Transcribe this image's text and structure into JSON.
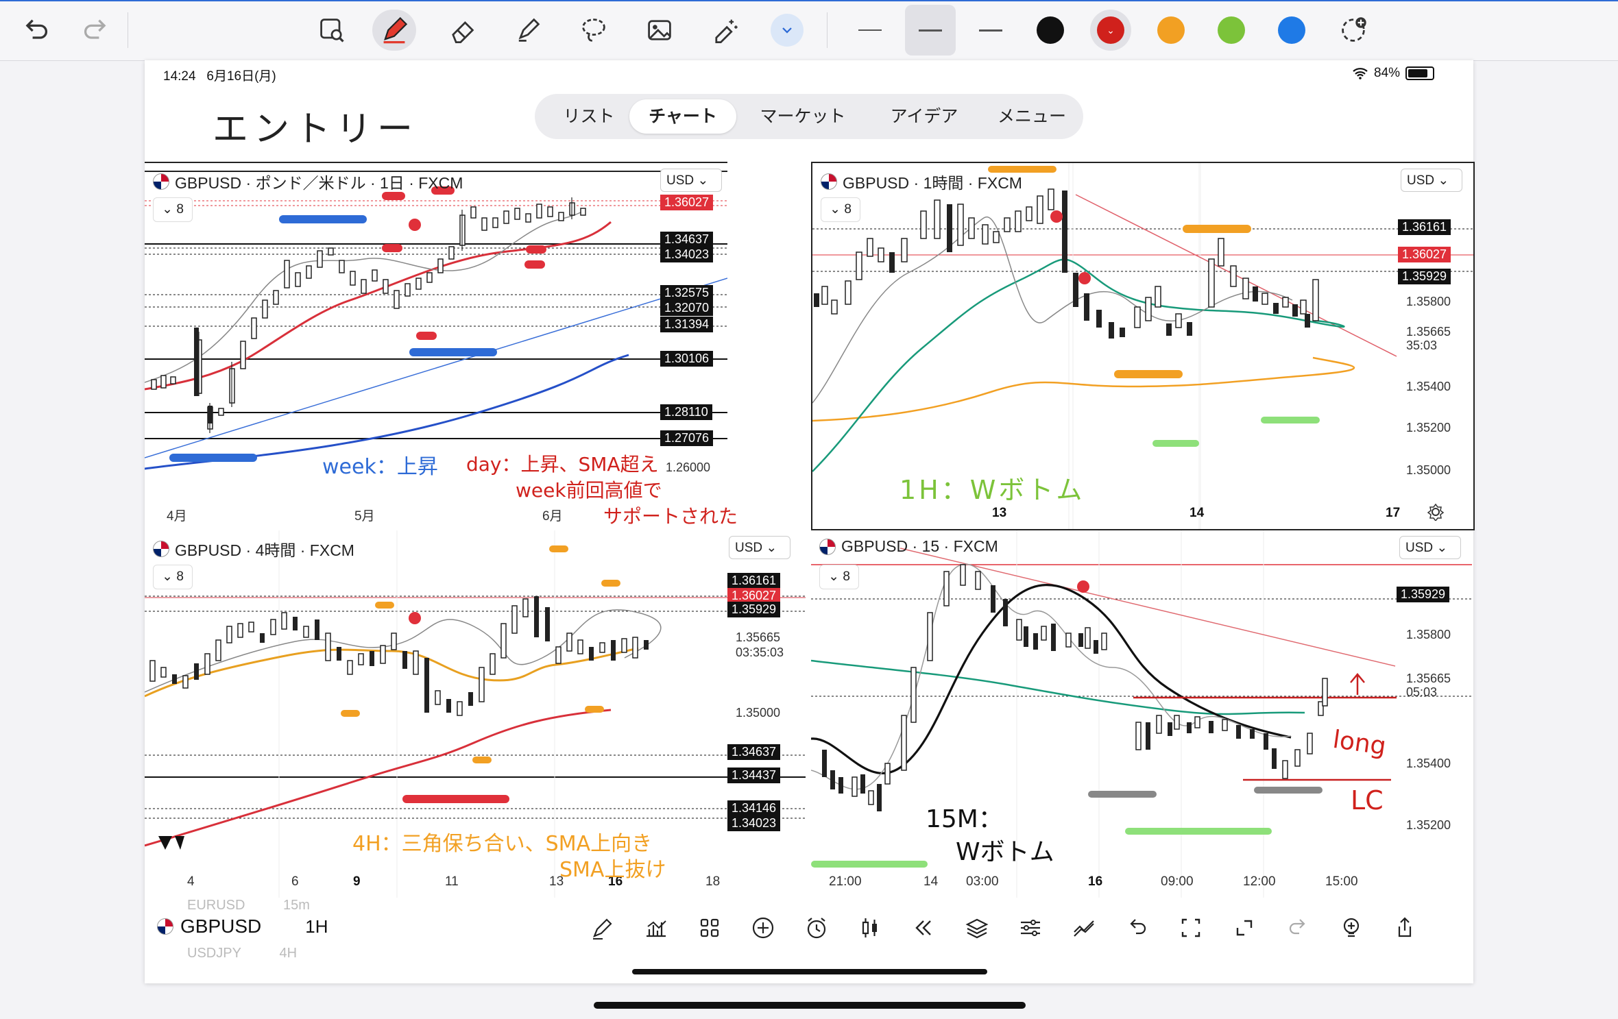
{
  "toolbar": {
    "icons": [
      "undo-icon",
      "redo-icon",
      "image-search-icon",
      "pen-icon",
      "eraser-icon",
      "highlighter-icon",
      "lasso-icon",
      "image-icon",
      "magic-eraser-icon",
      "chevron-down-icon"
    ],
    "colors": [
      "#111111",
      "#d0211c",
      "#f2a023",
      "#7cc33a",
      "#1f7ae6"
    ]
  },
  "status": {
    "time": "14:24",
    "date": "6月16日(月)",
    "battery": "84%"
  },
  "tabs": [
    "リスト",
    "チャート",
    "マーケット",
    "アイデア",
    "メニュー"
  ],
  "active_tab": "チャート",
  "notes": {
    "title": "エントリー",
    "week": "week：上昇",
    "day1": "day：上昇、SMA超え",
    "day2": "week前回高値で",
    "day3": "サポートされた",
    "h1": "1H：Wボトム",
    "h4a": "4H：三角保ち合い、SMA上向き",
    "h4b": "SMA上抜け",
    "m15a": "15M：",
    "m15b": "Wボトム",
    "long": "long",
    "lc": "LC"
  },
  "panels": {
    "daily": {
      "title": "GBPUSD · ポンド／米ドル · 1日 · FXCM",
      "currency": "USD",
      "interval": "8",
      "prices": [
        "1.32575",
        "1.32070",
        "1.31394",
        "1.26000"
      ],
      "tags": [
        "1.36027",
        "1.34637",
        "1.34023",
        "1.30106",
        "1.28110",
        "1.27076"
      ],
      "x_labels": [
        "4月",
        "5月",
        "6月"
      ]
    },
    "h1": {
      "title": "GBPUSD · 1時間 · FXCM",
      "currency": "USD",
      "interval": "8",
      "prices": [
        "1.35800",
        "1.35665",
        "35:03",
        "1.35400",
        "1.35200",
        "1.35000"
      ],
      "tags": [
        "1.36161",
        "1.36027",
        "1.35929"
      ],
      "x_labels": [
        "13",
        "14",
        "17"
      ]
    },
    "h4": {
      "title": "GBPUSD · 4時間 · FXCM",
      "currency": "USD",
      "interval": "8",
      "prices": [
        "1.35665",
        "03:35:03",
        "1.35000"
      ],
      "tags": [
        "1.36161",
        "1.36027",
        "1.35929",
        "1.34637",
        "1.34437",
        "1.34146",
        "1.34023"
      ],
      "x_labels": [
        "4",
        "6",
        "9",
        "11",
        "13",
        "16",
        "18"
      ]
    },
    "m15": {
      "title": "GBPUSD · 15 · FXCM",
      "currency": "USD",
      "interval": "8",
      "prices": [
        "1.35800",
        "1.35665",
        "05:03",
        "1.35400",
        "1.35200"
      ],
      "tags": [
        "1.35929"
      ],
      "x_labels": [
        "21:00",
        "14",
        "03:00",
        "16",
        "09:00",
        "12:00",
        "15:00"
      ]
    }
  },
  "bottom": {
    "symbol": "GBPUSD",
    "interval": "1H",
    "ghost_symbol_above": "EURUSD",
    "ghost_interval_above": "15m",
    "ghost_symbol_below": "USDJPY",
    "ghost_interval_below": "4H"
  }
}
